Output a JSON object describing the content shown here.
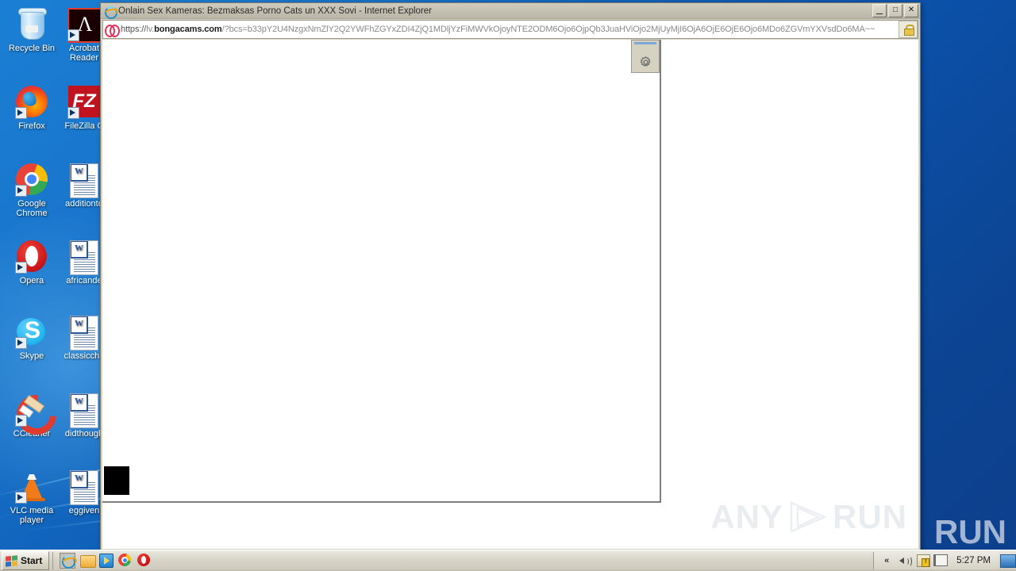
{
  "desktop": {
    "icons": [
      {
        "label": "Recycle Bin",
        "type": "recycle-bin",
        "shortcut": false,
        "col": 0,
        "row": 0
      },
      {
        "label": "Acrobat Reader",
        "type": "acrobat",
        "shortcut": true,
        "col": 1,
        "row": 0
      },
      {
        "label": "Firefox",
        "type": "firefox",
        "shortcut": true,
        "col": 0,
        "row": 1
      },
      {
        "label": "FileZilla C",
        "type": "filezilla",
        "shortcut": true,
        "col": 1,
        "row": 1
      },
      {
        "label": "Google Chrome",
        "type": "chrome",
        "shortcut": true,
        "col": 0,
        "row": 2
      },
      {
        "label": "additionto",
        "type": "word-doc",
        "shortcut": false,
        "col": 1,
        "row": 2
      },
      {
        "label": "Opera",
        "type": "opera",
        "shortcut": true,
        "col": 0,
        "row": 3
      },
      {
        "label": "africande",
        "type": "word-doc",
        "shortcut": false,
        "col": 1,
        "row": 3
      },
      {
        "label": "Skype",
        "type": "skype",
        "shortcut": true,
        "col": 0,
        "row": 4
      },
      {
        "label": "classiccha",
        "type": "word-doc",
        "shortcut": false,
        "col": 1,
        "row": 4
      },
      {
        "label": "CCleaner",
        "type": "ccleaner",
        "shortcut": true,
        "col": 0,
        "row": 5
      },
      {
        "label": "didthough",
        "type": "word-doc",
        "shortcut": false,
        "col": 1,
        "row": 5
      },
      {
        "label": "VLC media player",
        "type": "vlc",
        "shortcut": true,
        "col": 0,
        "row": 6
      },
      {
        "label": "eggiven",
        "type": "word-doc",
        "shortcut": false,
        "col": 1,
        "row": 6
      }
    ],
    "watermark": {
      "any": "ANY",
      "run": "RUN"
    }
  },
  "ie_window": {
    "title": "Onlain Sex Kameras: Bezmaksas Porno Čats un XXX Šovi - Internet Explorer",
    "logo_icon": "internet-explorer-icon",
    "controls": {
      "minimize": "_",
      "maximize": "□",
      "close": "✕"
    },
    "address_bar": {
      "favicon": "bongacams-favicon",
      "scheme": "https://",
      "host_prefix": "lv.",
      "host": "bongacams.com",
      "query": "/?bcs=b33pY2U4NzgxNmZlY2Q2YWFhZGYxZDI4ZjQ1MDljYzFiMWVkOjoyNTE2ODM6Ojo6OjpQb3JuaHViOjo2MjUyMjI6OjA6OjE6OjE6Ojo6MDo6ZGVmYXVsdDo6MA~~",
      "lock_icon": "secure-lock-icon"
    },
    "page": {
      "gear_toolbar": {
        "icon": "gear-icon"
      },
      "black_block": "black-placeholder-block",
      "watermark": {
        "any": "ANY",
        "run": "RUN"
      }
    }
  },
  "taskbar": {
    "start_label": "Start",
    "quicklaunch": [
      {
        "name": "internet-explorer",
        "icon": "internet-explorer-icon",
        "active": true
      },
      {
        "name": "windows-explorer",
        "icon": "folder-icon",
        "active": false
      },
      {
        "name": "media-player",
        "icon": "media-player-icon",
        "active": false
      },
      {
        "name": "google-chrome",
        "icon": "chrome-icon",
        "active": false
      },
      {
        "name": "opera",
        "icon": "opera-icon",
        "active": false
      }
    ],
    "tray": [
      {
        "name": "show-hidden-icons",
        "icon": "chevron-up-icon",
        "glyph": "«"
      },
      {
        "name": "volume",
        "icon": "speaker-icon"
      },
      {
        "name": "security-alert",
        "icon": "shield-warning-icon"
      },
      {
        "name": "network-flag",
        "icon": "flag-icon"
      }
    ],
    "clock": "5:27 PM",
    "show_desktop": "show-desktop-button"
  },
  "colors": {
    "desktop_blue": "#0b4fa6",
    "window_chrome": "#d6d2c2",
    "taskbar": "#d8d5c8",
    "accent_orange": "#f0a30a"
  }
}
